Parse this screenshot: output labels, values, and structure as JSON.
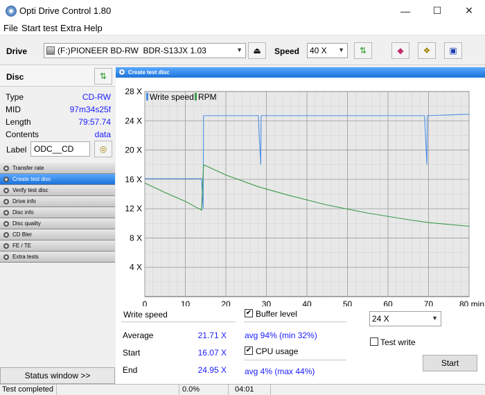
{
  "window": {
    "title": "Opti Drive Control 1.80",
    "min": "—",
    "max": "☐",
    "close": "✕"
  },
  "menu": [
    "File",
    "Start test",
    "Extra",
    "Help"
  ],
  "drivebar": {
    "drive_label": "Drive",
    "drive_letter": "(F:)",
    "drive_name": "PIONEER BD-RW  BDR-S13JX 1.03",
    "speed_label": "Speed",
    "speed_value": "40 X"
  },
  "disc": {
    "header": "Disc",
    "rows": [
      {
        "key": "Type",
        "value": "CD-RW"
      },
      {
        "key": "MID",
        "value": "97m34s25f"
      },
      {
        "key": "Length",
        "value": "79:57.74"
      },
      {
        "key": "Contents",
        "value": "data"
      }
    ],
    "label_key": "Label",
    "label_value": "ODC__CD"
  },
  "nav": [
    {
      "label": "Transfer rate",
      "active": false
    },
    {
      "label": "Create test disc",
      "active": true
    },
    {
      "label": "Verify test disc",
      "active": false
    },
    {
      "label": "Drive info",
      "active": false
    },
    {
      "label": "Disc info",
      "active": false
    },
    {
      "label": "Disc quality",
      "active": false
    },
    {
      "label": "CD Bler",
      "active": false
    },
    {
      "label": "FE / TE",
      "active": false
    },
    {
      "label": "Extra tests",
      "active": false
    }
  ],
  "status_window_label": "Status window >>",
  "panel_title": "Create test disc",
  "chart_data": {
    "type": "line",
    "x_unit": "min",
    "xlim": [
      0,
      80
    ],
    "ylim": [
      0,
      28
    ],
    "x_ticks": [
      0,
      10,
      20,
      30,
      40,
      50,
      60,
      70,
      80
    ],
    "y_ticks": [
      4,
      8,
      12,
      16,
      20,
      24,
      28
    ],
    "y_tick_labels": [
      "4 X",
      "8 X",
      "12 X",
      "16 X",
      "20 X",
      "24 X",
      "28 X"
    ],
    "x_tick_labels": [
      "0",
      "10",
      "20",
      "30",
      "40",
      "50",
      "60",
      "70",
      "80 min"
    ],
    "grid": true,
    "legend": "top-left",
    "series": [
      {
        "name": "Write speed",
        "color": "#4a90e2",
        "x": [
          0,
          14,
          14.4,
          14.5,
          14.8,
          28,
          28.6,
          28.7,
          29,
          69,
          69.6,
          69.7,
          70,
          80
        ],
        "y": [
          16.1,
          16.1,
          12,
          24.7,
          24.7,
          24.7,
          18,
          24.7,
          24.7,
          24.7,
          18,
          24.7,
          24.7,
          24.9
        ]
      },
      {
        "name": "RPM",
        "color": "#3a9a4a",
        "x": [
          0,
          5,
          10,
          14,
          14.5,
          20,
          28,
          35,
          45,
          55,
          65,
          70,
          80
        ],
        "y": [
          15.5,
          14.2,
          13,
          11.8,
          18,
          16.6,
          15,
          13.9,
          12.5,
          11.4,
          10.5,
          10.1,
          9.6
        ]
      }
    ]
  },
  "stats": {
    "write_speed_label": "Write speed",
    "average_label": "Average",
    "average_value": "21.71 X",
    "start_label": "Start",
    "start_value": "16.07 X",
    "end_label": "End",
    "end_value": "24.95 X"
  },
  "buffer": {
    "label": "Buffer level",
    "checked": "✔",
    "value": "avg 94% (min 32%)"
  },
  "cpu": {
    "label": "CPU usage",
    "checked": "✔",
    "value": "avg 4% (max 44%)"
  },
  "controls": {
    "speed_select": "24 X",
    "test_write_label": "Test write",
    "start_label": "Start"
  },
  "statusbar": {
    "status": "Test completed",
    "progress": "0.0%",
    "time": "04:01"
  }
}
